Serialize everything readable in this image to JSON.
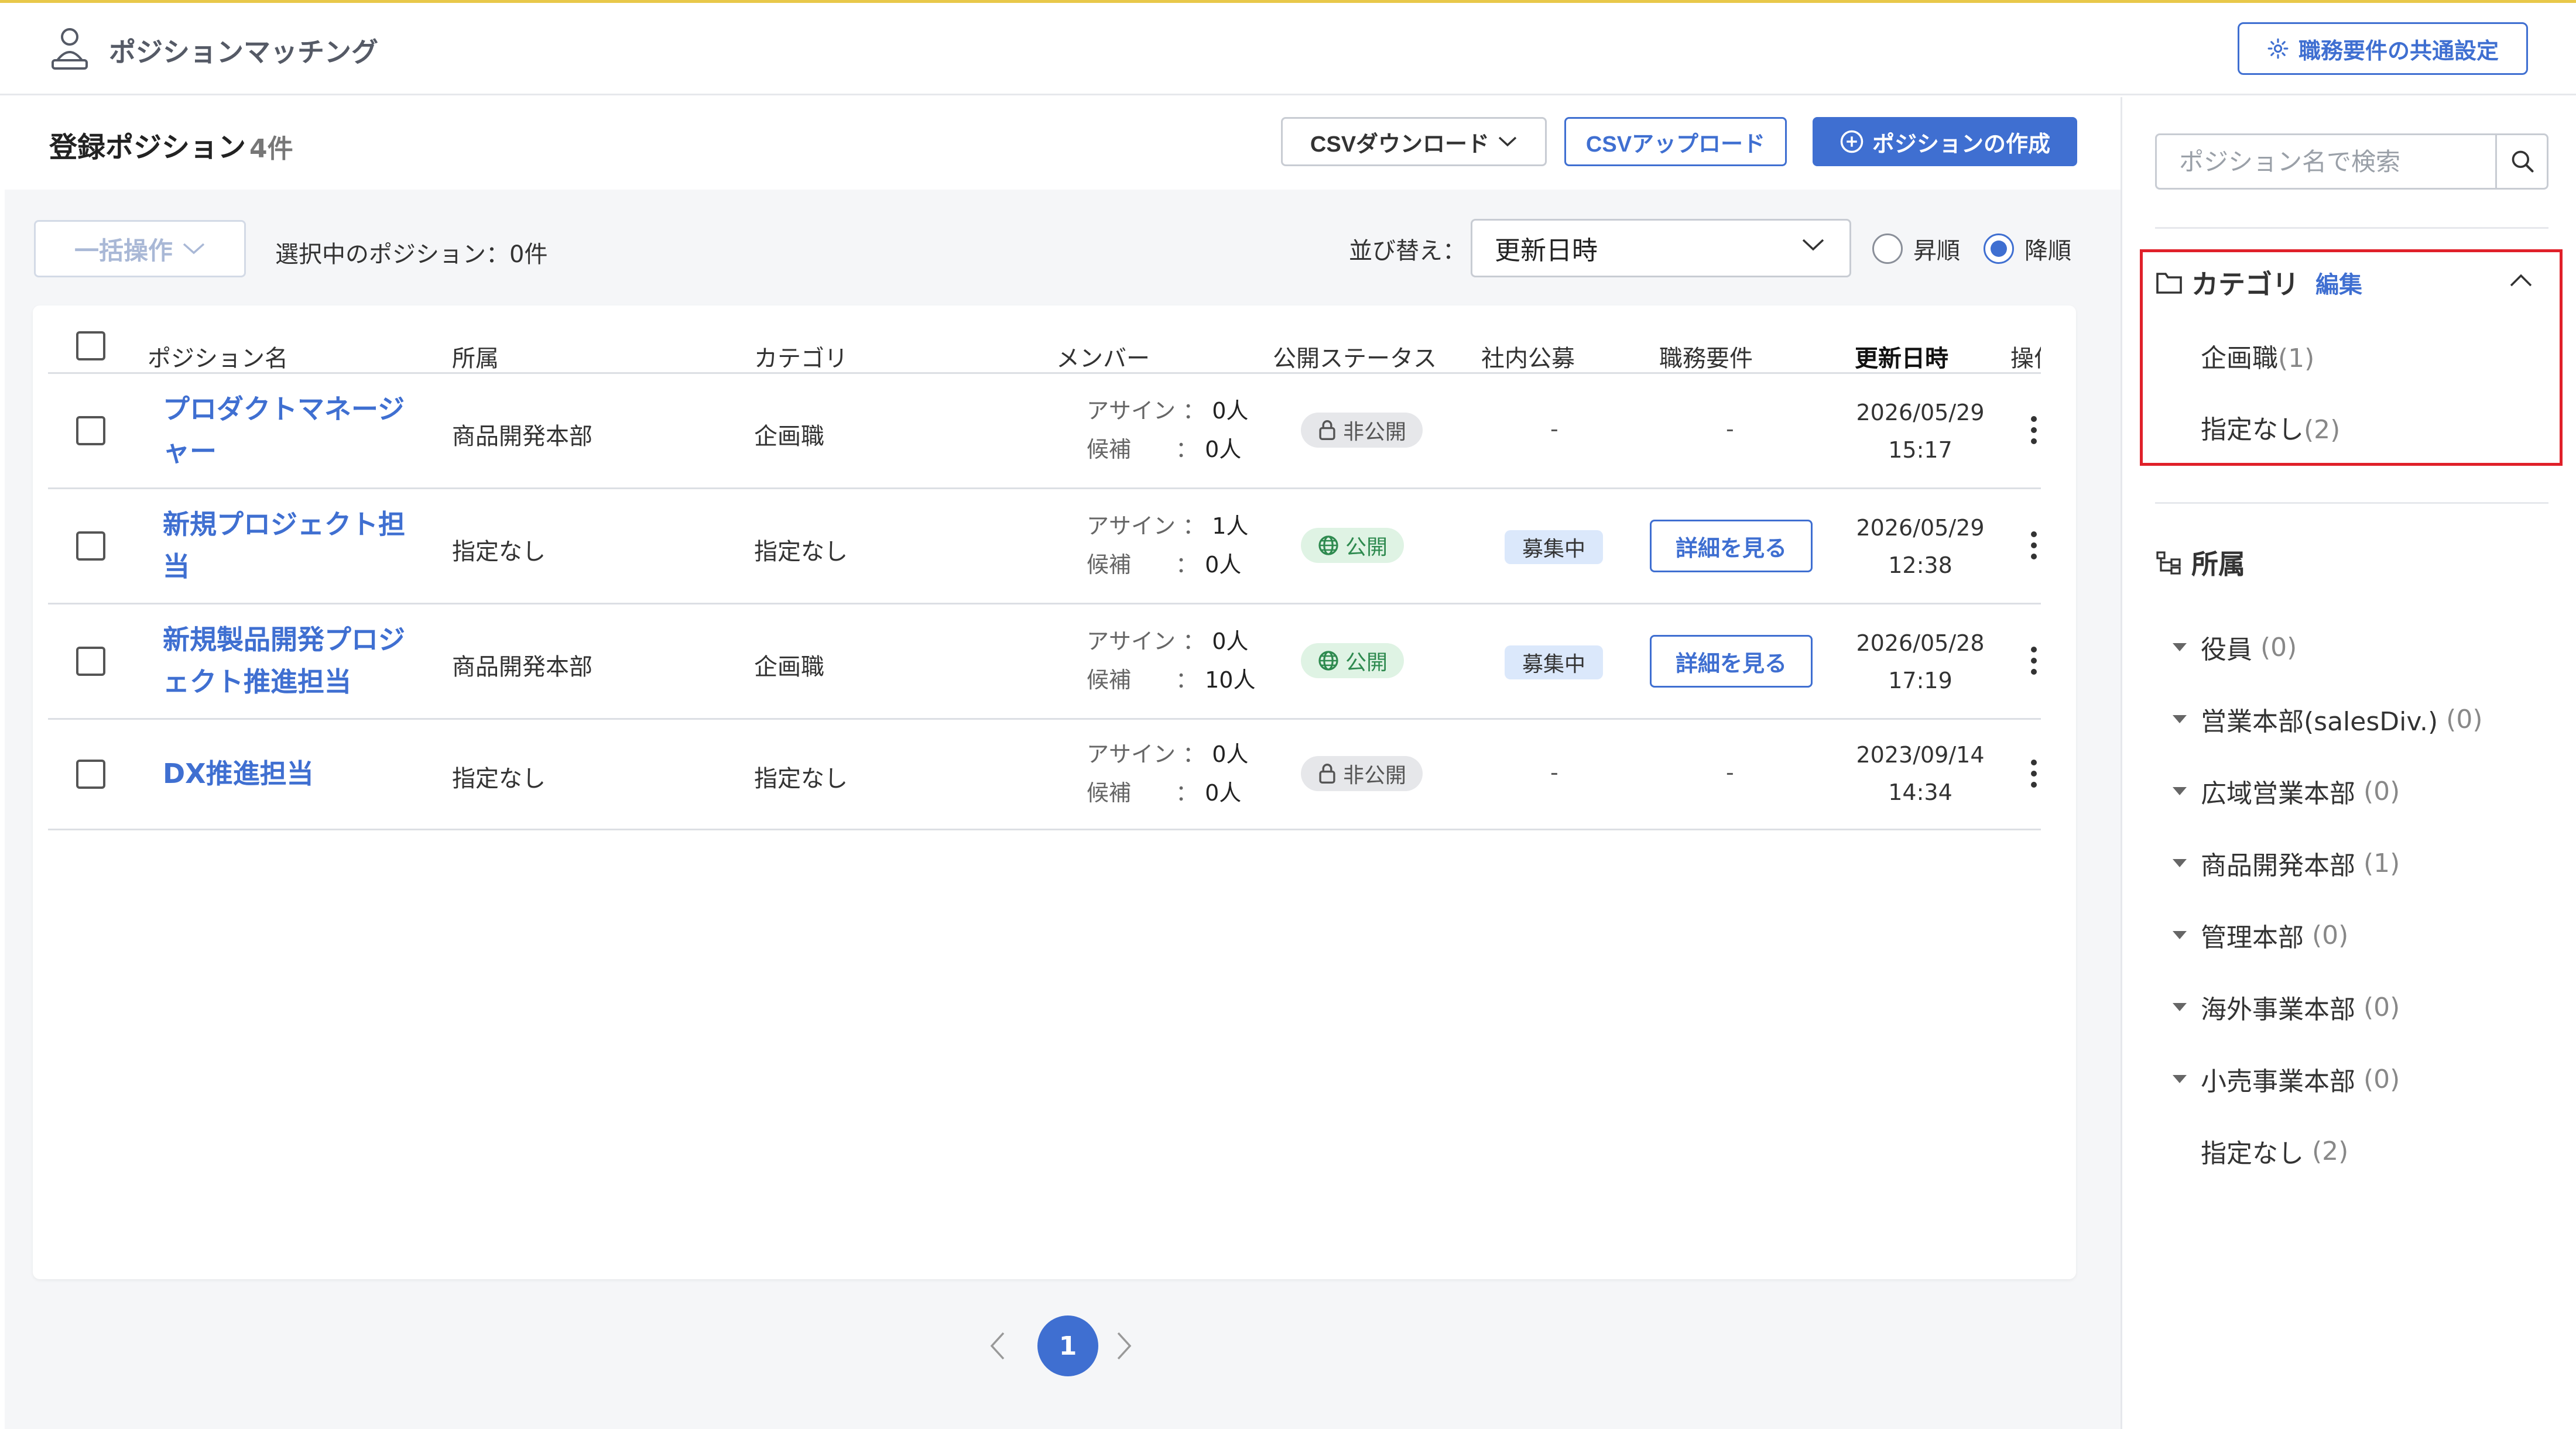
{
  "header": {
    "app_title": "ポジションマッチング",
    "common_settings_label": "職務要件の共通設定"
  },
  "main": {
    "title": "登録ポジション",
    "count": "4件",
    "csv_download_label": "CSVダウンロード",
    "csv_upload_label": "CSVアップロード",
    "create_label": "ポジションの作成",
    "bulk_action_label": "一括操作",
    "selected_text": "選択中のポジション：0件",
    "sort_label": "並び替え：",
    "sort_value": "更新日時",
    "asc_label": "昇順",
    "desc_label": "降順",
    "sort_order": "desc"
  },
  "table": {
    "headers": {
      "name": "ポジション名",
      "dept": "所属",
      "category": "カテゴリ",
      "member": "メンバー",
      "status": "公開ステータス",
      "recruit": "社内公募",
      "requirement": "職務要件",
      "updated": "更新日時",
      "ops": "操作"
    },
    "member_labels": {
      "assign": "アサイン ：",
      "candidate": "候補　　："
    },
    "rows": [
      {
        "name_line1": "プロダクトマネージ",
        "name_line2": "ャー",
        "dept": "商品開発本部",
        "category": "企画職",
        "assign": "0人",
        "candidate": "0人",
        "status": "非公開",
        "recruit": "-",
        "requirement": "-",
        "date": "2026/05/29",
        "time": "15:17"
      },
      {
        "name_line1": "新規プロジェクト担",
        "name_line2": "当",
        "dept": "指定なし",
        "category": "指定なし",
        "assign": "1人",
        "candidate": "0人",
        "status": "公開",
        "recruit": "募集中",
        "requirement": "詳細を見る",
        "date": "2026/05/29",
        "time": "12:38"
      },
      {
        "name_line1": "新規製品開発プロジ",
        "name_line2": "ェクト推進担当",
        "dept": "商品開発本部",
        "category": "企画職",
        "assign": "0人",
        "candidate": "10人",
        "status": "公開",
        "recruit": "募集中",
        "requirement": "詳細を見る",
        "date": "2026/05/28",
        "time": "17:19"
      },
      {
        "name_line1": "DX推進担当",
        "name_line2": "",
        "dept": "指定なし",
        "category": "指定なし",
        "assign": "0人",
        "candidate": "0人",
        "status": "非公開",
        "recruit": "-",
        "requirement": "-",
        "date": "2023/09/14",
        "time": "14:34"
      }
    ]
  },
  "pagination": {
    "current": "1"
  },
  "sidebar": {
    "search_placeholder": "ポジション名で検索",
    "category": {
      "title": "カテゴリ",
      "edit_label": "編集",
      "items": [
        {
          "label": "企画職",
          "count": "(1)"
        },
        {
          "label": "指定なし",
          "count": "(2)"
        }
      ]
    },
    "dept": {
      "title": "所属",
      "items": [
        {
          "label": "役員",
          "count": "(0)"
        },
        {
          "label": "営業本部(salesDiv.)",
          "count": "(0)"
        },
        {
          "label": "広域営業本部",
          "count": "(0)"
        },
        {
          "label": "商品開発本部",
          "count": "(1)"
        },
        {
          "label": "管理本部",
          "count": "(0)"
        },
        {
          "label": "海外事業本部",
          "count": "(0)"
        },
        {
          "label": "小売事業本部",
          "count": "(0)"
        },
        {
          "label": "指定なし",
          "count": "(2)"
        }
      ]
    }
  },
  "colors": {
    "accent": "#3f6fd1",
    "public_badge": "#2e8a4f",
    "highlight_box": "#e0202a",
    "top_border": "#e8c84a"
  }
}
